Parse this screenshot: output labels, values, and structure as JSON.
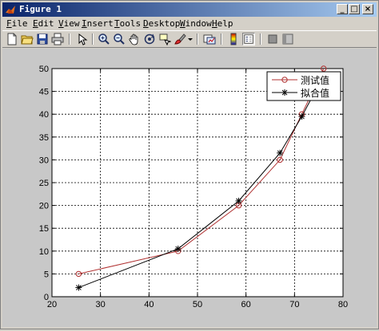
{
  "window": {
    "title": "Figure 1",
    "controls": {
      "minimize": "_",
      "maximize": "□",
      "close": "×"
    }
  },
  "menubar": {
    "items": [
      {
        "key": "F",
        "rest": "ile"
      },
      {
        "key": "E",
        "rest": "dit"
      },
      {
        "key": "V",
        "rest": "iew"
      },
      {
        "key": "I",
        "rest": "nsert"
      },
      {
        "key": "T",
        "rest": "ools"
      },
      {
        "key": "D",
        "rest": "esktop"
      },
      {
        "key": "W",
        "rest": "indow"
      },
      {
        "key": "H",
        "rest": "elp"
      }
    ]
  },
  "toolbar": {
    "icons": [
      "new-file-icon",
      "open-folder-icon",
      "save-icon",
      "print-icon",
      "pointer-icon",
      "zoom-in-icon",
      "zoom-out-icon",
      "pan-hand-icon",
      "rotate-3d-icon",
      "data-cursor-icon",
      "brush-icon",
      "dropdown-arrow-icon",
      "link-plot-icon",
      "colorbar-icon",
      "legend-icon",
      "hide-plot-tools-icon",
      "show-plot-tools-icon"
    ]
  },
  "colors": {
    "measured": "#b03030",
    "fitted": "#000000",
    "grid": "#000000"
  },
  "chart_data": {
    "type": "line",
    "title": "",
    "xlabel": "",
    "ylabel": "",
    "xlim": [
      20,
      80
    ],
    "ylim": [
      0,
      50
    ],
    "xticks": [
      "20",
      "30",
      "40",
      "50",
      "60",
      "70",
      "80"
    ],
    "yticks": [
      "0",
      "5",
      "10",
      "15",
      "20",
      "25",
      "30",
      "35",
      "40",
      "45",
      "50"
    ],
    "grid": true,
    "legend_position": "top-right",
    "series": [
      {
        "name": "测试值",
        "marker": "circle",
        "color": "#b03030",
        "x": [
          25.5,
          46.0,
          58.5,
          67.0,
          71.5,
          76.0
        ],
        "y": [
          5.0,
          10.0,
          20.0,
          30.0,
          40.0,
          50.0
        ]
      },
      {
        "name": "拟合值",
        "marker": "star",
        "color": "#000000",
        "x": [
          25.5,
          46.0,
          58.5,
          67.0,
          71.5,
          76.0
        ],
        "y": [
          2.0,
          10.5,
          21.0,
          31.5,
          39.5,
          48.5
        ]
      }
    ]
  }
}
